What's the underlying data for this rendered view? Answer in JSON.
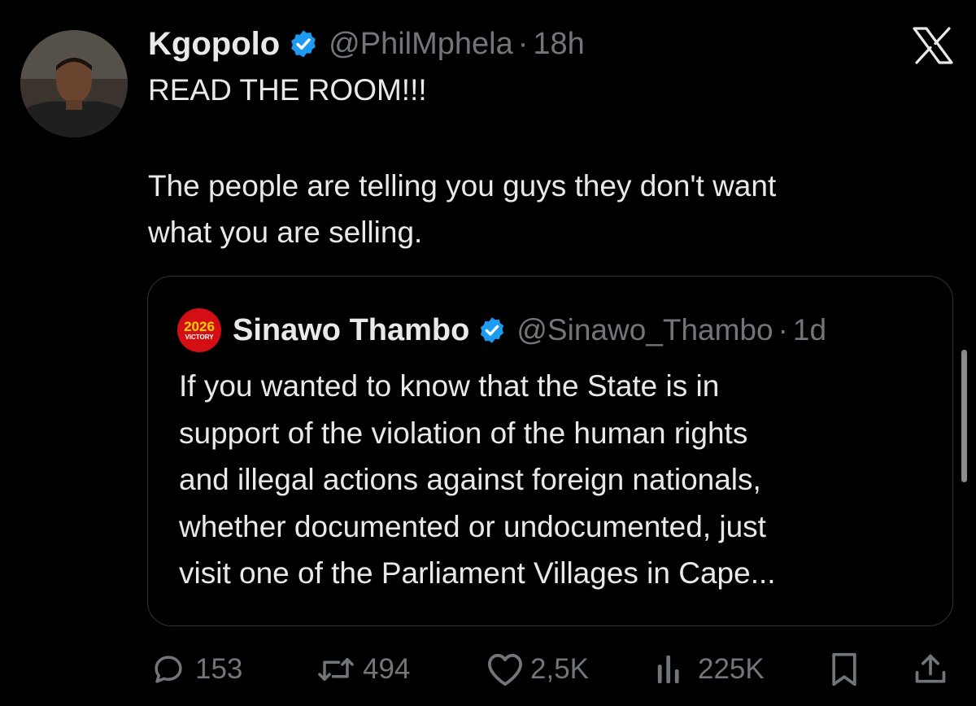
{
  "tweet": {
    "author_name": "Kgopolo",
    "handle": "@PhilMphela",
    "separator": "·",
    "time": "18h",
    "text_lines": [
      "READ THE ROOM!!!",
      "The people are telling you guys they don't want",
      "what you are selling."
    ]
  },
  "quoted": {
    "author_name": "Sinawo Thambo",
    "handle": "@Sinawo_Thambo",
    "separator": "·",
    "time": "1d",
    "avatar_year": "2026",
    "avatar_text": "VICTORY",
    "text_lines": [
      "If you wanted to know that the State is in",
      "support of the violation of the human rights",
      "and illegal actions against foreign nationals,",
      "whether documented or undocumented, just",
      "visit one of the Parliament Villages in Cape..."
    ]
  },
  "actions": {
    "replies": "153",
    "reposts": "494",
    "likes": "2,5K",
    "views": "225K"
  },
  "icons": {
    "verified": "verified-badge-icon",
    "close": "x-logo-icon",
    "reply": "reply-icon",
    "repost": "repost-icon",
    "like": "heart-icon",
    "views": "views-icon",
    "bookmark": "bookmark-icon",
    "share": "share-icon"
  },
  "colors": {
    "background": "#000000",
    "text": "#e7e9ea",
    "muted": "#71767b",
    "verified": "#1d9bf0",
    "border": "#2f3336"
  }
}
